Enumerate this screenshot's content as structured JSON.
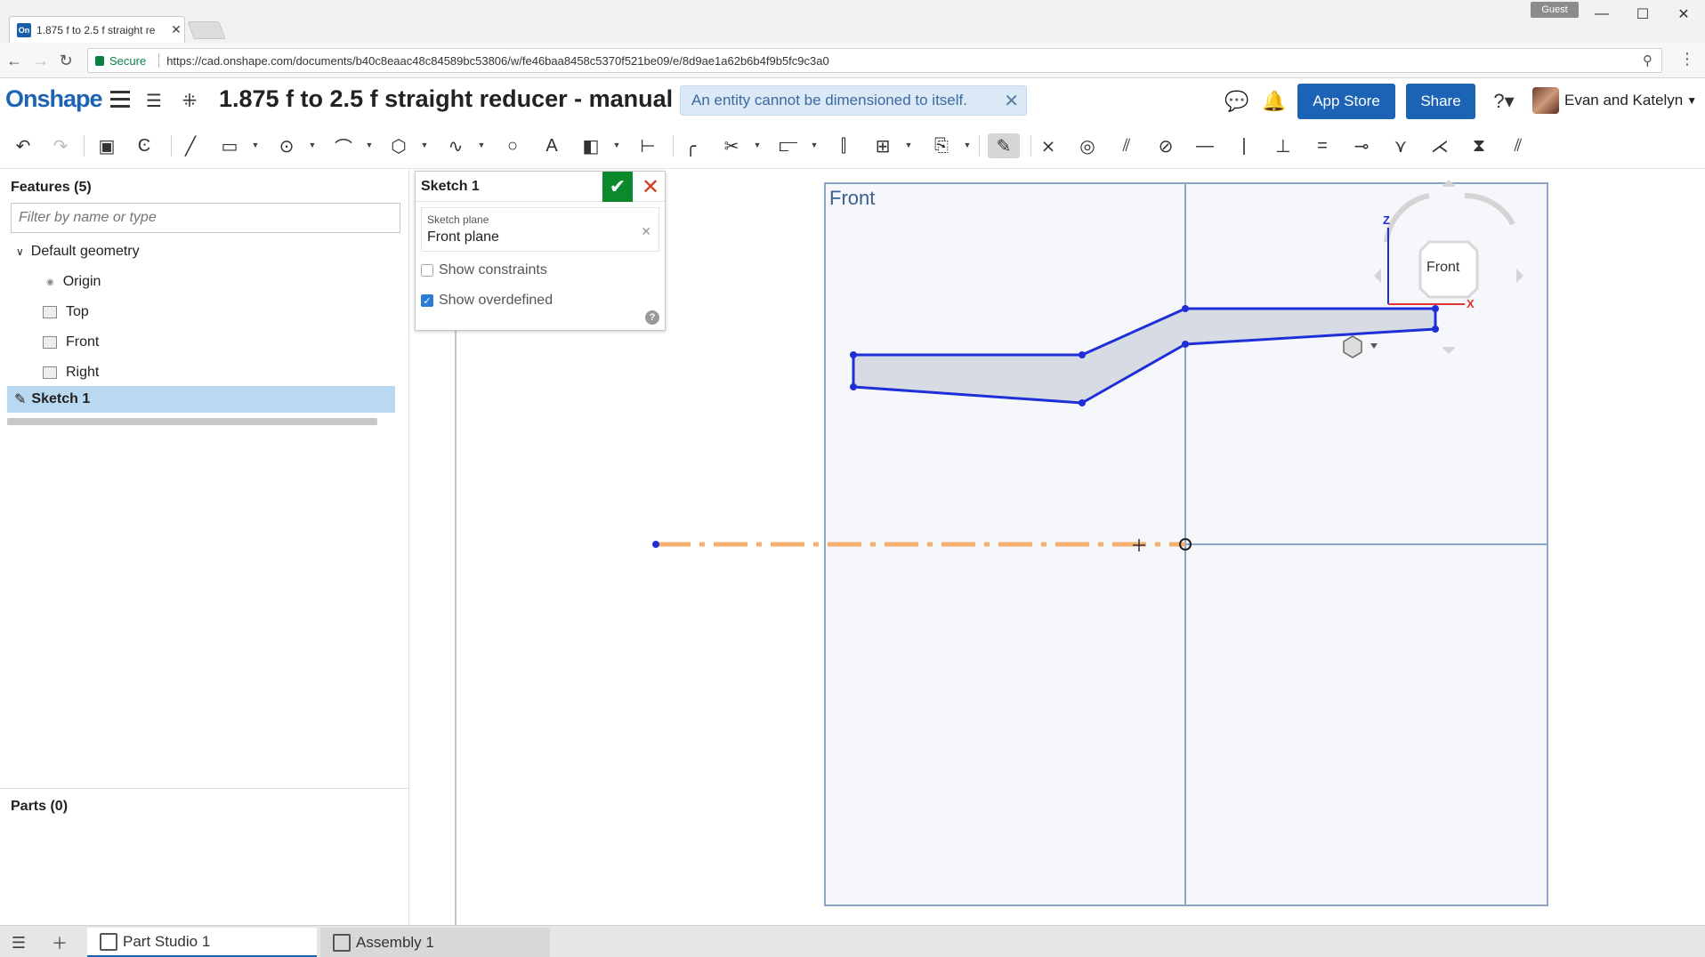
{
  "browser": {
    "tab_title": "1.875 f to 2.5 f straight re",
    "favicon": "On",
    "guest_label": "Guest",
    "secure_label": "Secure",
    "url": "https://cad.onshape.com/documents/b40c8eaac48c84589bc53806/w/fe46baa8458c5370f521be09/e/8d9ae1a62b6b4f9b5fc9c3a0"
  },
  "app": {
    "logo": "Onshape",
    "document_title": "1.875 f to 2.5 f straight reducer - manual",
    "toast_message": "An entity cannot be dimensioned to itself.",
    "app_store_label": "App Store",
    "share_label": "Share",
    "user_name": "Evan and Katelyn"
  },
  "feature_panel": {
    "title": "Features (5)",
    "filter_placeholder": "Filter by name or type",
    "default_geometry_label": "Default geometry",
    "items": [
      "Origin",
      "Top",
      "Front",
      "Right"
    ],
    "sketch_label": "Sketch 1",
    "parts_title": "Parts (0)"
  },
  "sketch_dialog": {
    "title": "Sketch 1",
    "plane_label": "Sketch plane",
    "plane_value": "Front plane",
    "show_constraints_label": "Show constraints",
    "show_constraints_checked": false,
    "show_overdefined_label": "Show overdefined",
    "show_overdefined_checked": true,
    "help_glyph": "?"
  },
  "canvas": {
    "plane_label": "Front",
    "view_cube_label": "Front",
    "axis_z": "Z",
    "axis_x": "X"
  },
  "bottom_tabs": [
    {
      "label": "Part Studio 1",
      "active": true
    },
    {
      "label": "Assembly 1",
      "active": false
    }
  ],
  "colors": {
    "brand_blue": "#1d63b5",
    "sketch_blue": "#1f2fd8",
    "construction_orange": "#f5b070",
    "ok_green": "#0a8a2c",
    "cancel_red": "#d23b1f"
  }
}
